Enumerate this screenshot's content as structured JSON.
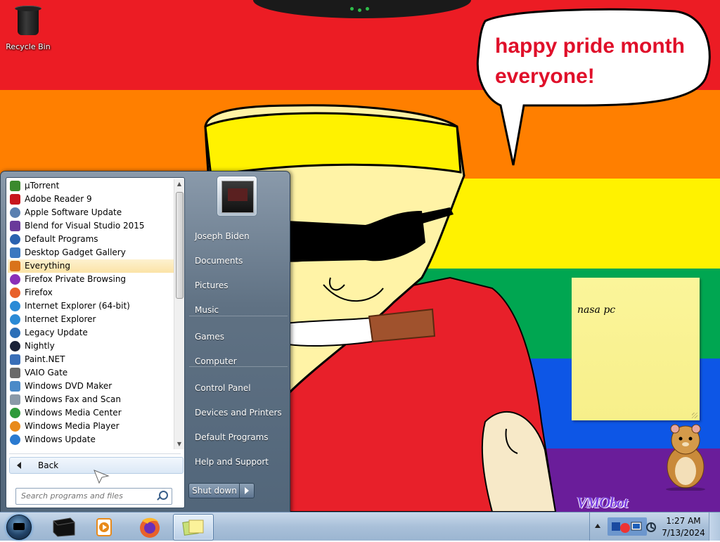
{
  "desktop": {
    "recycle_bin_label": "Recycle Bin",
    "speech_bubble": [
      "happy pride month",
      "everyone!"
    ],
    "sticky_note_text": "nasa pc",
    "watermark": "VMObot"
  },
  "start_menu": {
    "programs": [
      {
        "label": "µTorrent",
        "icon": "utorrent-icon",
        "color": "#3b8a2e"
      },
      {
        "label": "Adobe Reader 9",
        "icon": "adobe-reader-icon",
        "color": "#c8161d"
      },
      {
        "label": "Apple Software Update",
        "icon": "apple-update-icon",
        "color": "#5a7fb0"
      },
      {
        "label": "Blend for Visual Studio 2015",
        "icon": "blend-icon",
        "color": "#6a3a9a"
      },
      {
        "label": "Default Programs",
        "icon": "default-programs-icon",
        "color": "#2a62b0"
      },
      {
        "label": "Desktop Gadget Gallery",
        "icon": "gadget-gallery-icon",
        "color": "#3a78c0"
      },
      {
        "label": "Everything",
        "icon": "everything-search-icon",
        "color": "#d9731a"
      },
      {
        "label": "Firefox Private Browsing",
        "icon": "firefox-private-icon",
        "color": "#8a2fb8"
      },
      {
        "label": "Firefox",
        "icon": "firefox-icon",
        "color": "#e8612b"
      },
      {
        "label": "Internet Explorer (64-bit)",
        "icon": "internet-explorer-icon",
        "color": "#2a8ad6"
      },
      {
        "label": "Internet Explorer",
        "icon": "internet-explorer-icon",
        "color": "#2a8ad6"
      },
      {
        "label": "Legacy Update",
        "icon": "legacy-update-icon",
        "color": "#2c6fb8"
      },
      {
        "label": "Nightly",
        "icon": "nightly-icon",
        "color": "#1a2238"
      },
      {
        "label": "Paint.NET",
        "icon": "paintnet-icon",
        "color": "#3a6fb8"
      },
      {
        "label": "VAIO Gate",
        "icon": "vaio-gate-icon",
        "color": "#6a6a6a"
      },
      {
        "label": "Windows DVD Maker",
        "icon": "dvd-maker-icon",
        "color": "#4a8ac8"
      },
      {
        "label": "Windows Fax and Scan",
        "icon": "fax-scan-icon",
        "color": "#8a9aa8"
      },
      {
        "label": "Windows Media Center",
        "icon": "media-center-icon",
        "color": "#2e9a3a"
      },
      {
        "label": "Windows Media Player",
        "icon": "media-player-icon",
        "color": "#e88a1a"
      },
      {
        "label": "Windows Update",
        "icon": "windows-update-icon",
        "color": "#2a7ad0"
      }
    ],
    "selected_index": 6,
    "back_label": "Back",
    "search_placeholder": "Search programs and files",
    "right_links": [
      {
        "label": "Joseph Biden",
        "name": "user-name-link"
      },
      {
        "label": "Documents",
        "name": "documents-link"
      },
      {
        "label": "Pictures",
        "name": "pictures-link"
      },
      {
        "label": "Music",
        "name": "music-link"
      },
      {
        "label": "Games",
        "name": "games-link"
      },
      {
        "label": "Computer",
        "name": "computer-link"
      },
      {
        "label": "Control Panel",
        "name": "control-panel-link"
      },
      {
        "label": "Devices and Printers",
        "name": "devices-printers-link"
      },
      {
        "label": "Default Programs",
        "name": "default-programs-link"
      },
      {
        "label": "Help and Support",
        "name": "help-support-link"
      }
    ],
    "shutdown_label": "Shut down"
  },
  "taskbar": {
    "pinned": [
      {
        "name": "taskbar-terminal-button",
        "icon": "black-box-icon"
      },
      {
        "name": "taskbar-media-player-button",
        "icon": "media-player-icon"
      },
      {
        "name": "taskbar-firefox-button",
        "icon": "firefox-icon"
      },
      {
        "name": "taskbar-sticky-notes-button",
        "icon": "sticky-notes-icon"
      }
    ],
    "clock_time": "1:27 AM",
    "clock_date": "7/13/2024"
  },
  "colors": {
    "stripe_red": "#ec1c24",
    "stripe_orange": "#ff7f00",
    "stripe_yellow": "#fff200",
    "stripe_green": "#00a651",
    "stripe_blue": "#0d56e6",
    "stripe_purple": "#6a1d9a",
    "selected_highlight": "#fbe3a7"
  }
}
